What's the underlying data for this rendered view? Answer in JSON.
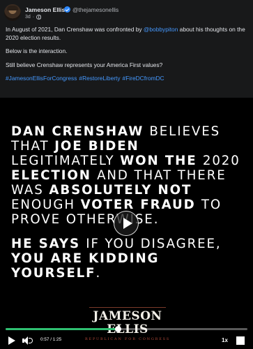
{
  "post": {
    "author": "Jameson Ellis",
    "handle": "@thejamesonellis",
    "time": "3d",
    "meta_separator": "·",
    "body_line1_before": "In August of 2021, Dan Crenshaw was confronted by ",
    "body_line1_mention": "@bobbypiton",
    "body_line1_after": " about his thoughts on the 2020 election results.",
    "body_line2": "Below is the interaction.",
    "body_line3": "Still believe Crenshaw represents your America First values?",
    "hashtags": [
      "#JamesonEllisForCongress",
      "#RestoreLiberty",
      "#FireDCfromDC"
    ]
  },
  "video": {
    "text1": [
      {
        "t": "Dan Crenshaw ",
        "bold": true
      },
      {
        "t": "believes that ",
        "bold": false
      },
      {
        "t": "Joe Biden ",
        "bold": true
      },
      {
        "t": "legitimately ",
        "bold": false
      },
      {
        "t": "won the ",
        "bold": true
      },
      {
        "t": "2020 ",
        "bold": false
      },
      {
        "t": "election ",
        "bold": true
      },
      {
        "t": "and that there was ",
        "bold": false
      },
      {
        "t": "absolutely not ",
        "bold": true
      },
      {
        "t": "enough ",
        "bold": false
      },
      {
        "t": "voter fraud ",
        "bold": true
      },
      {
        "t": "to prove otherwise.",
        "bold": false
      }
    ],
    "text2": [
      {
        "t": "He says ",
        "bold": true
      },
      {
        "t": "if you disagree, ",
        "bold": false
      },
      {
        "t": "you are kidding yourself",
        "bold": true
      },
      {
        "t": ".",
        "bold": false
      }
    ],
    "brand_name": "JAMESON ELLIS",
    "brand_sub": "REPUBLICAN FOR CONGRESS",
    "progress_fraction": 0.464,
    "current_time": "0:57",
    "duration": "1:25",
    "time_separator": " / ",
    "speed": "1x",
    "colors": {
      "progress": "#2fbf71",
      "link": "#4599ff"
    }
  },
  "icons": [
    "avatar",
    "verified-icon",
    "globe-icon",
    "play-icon",
    "volume-icon",
    "fullscreen-icon"
  ]
}
